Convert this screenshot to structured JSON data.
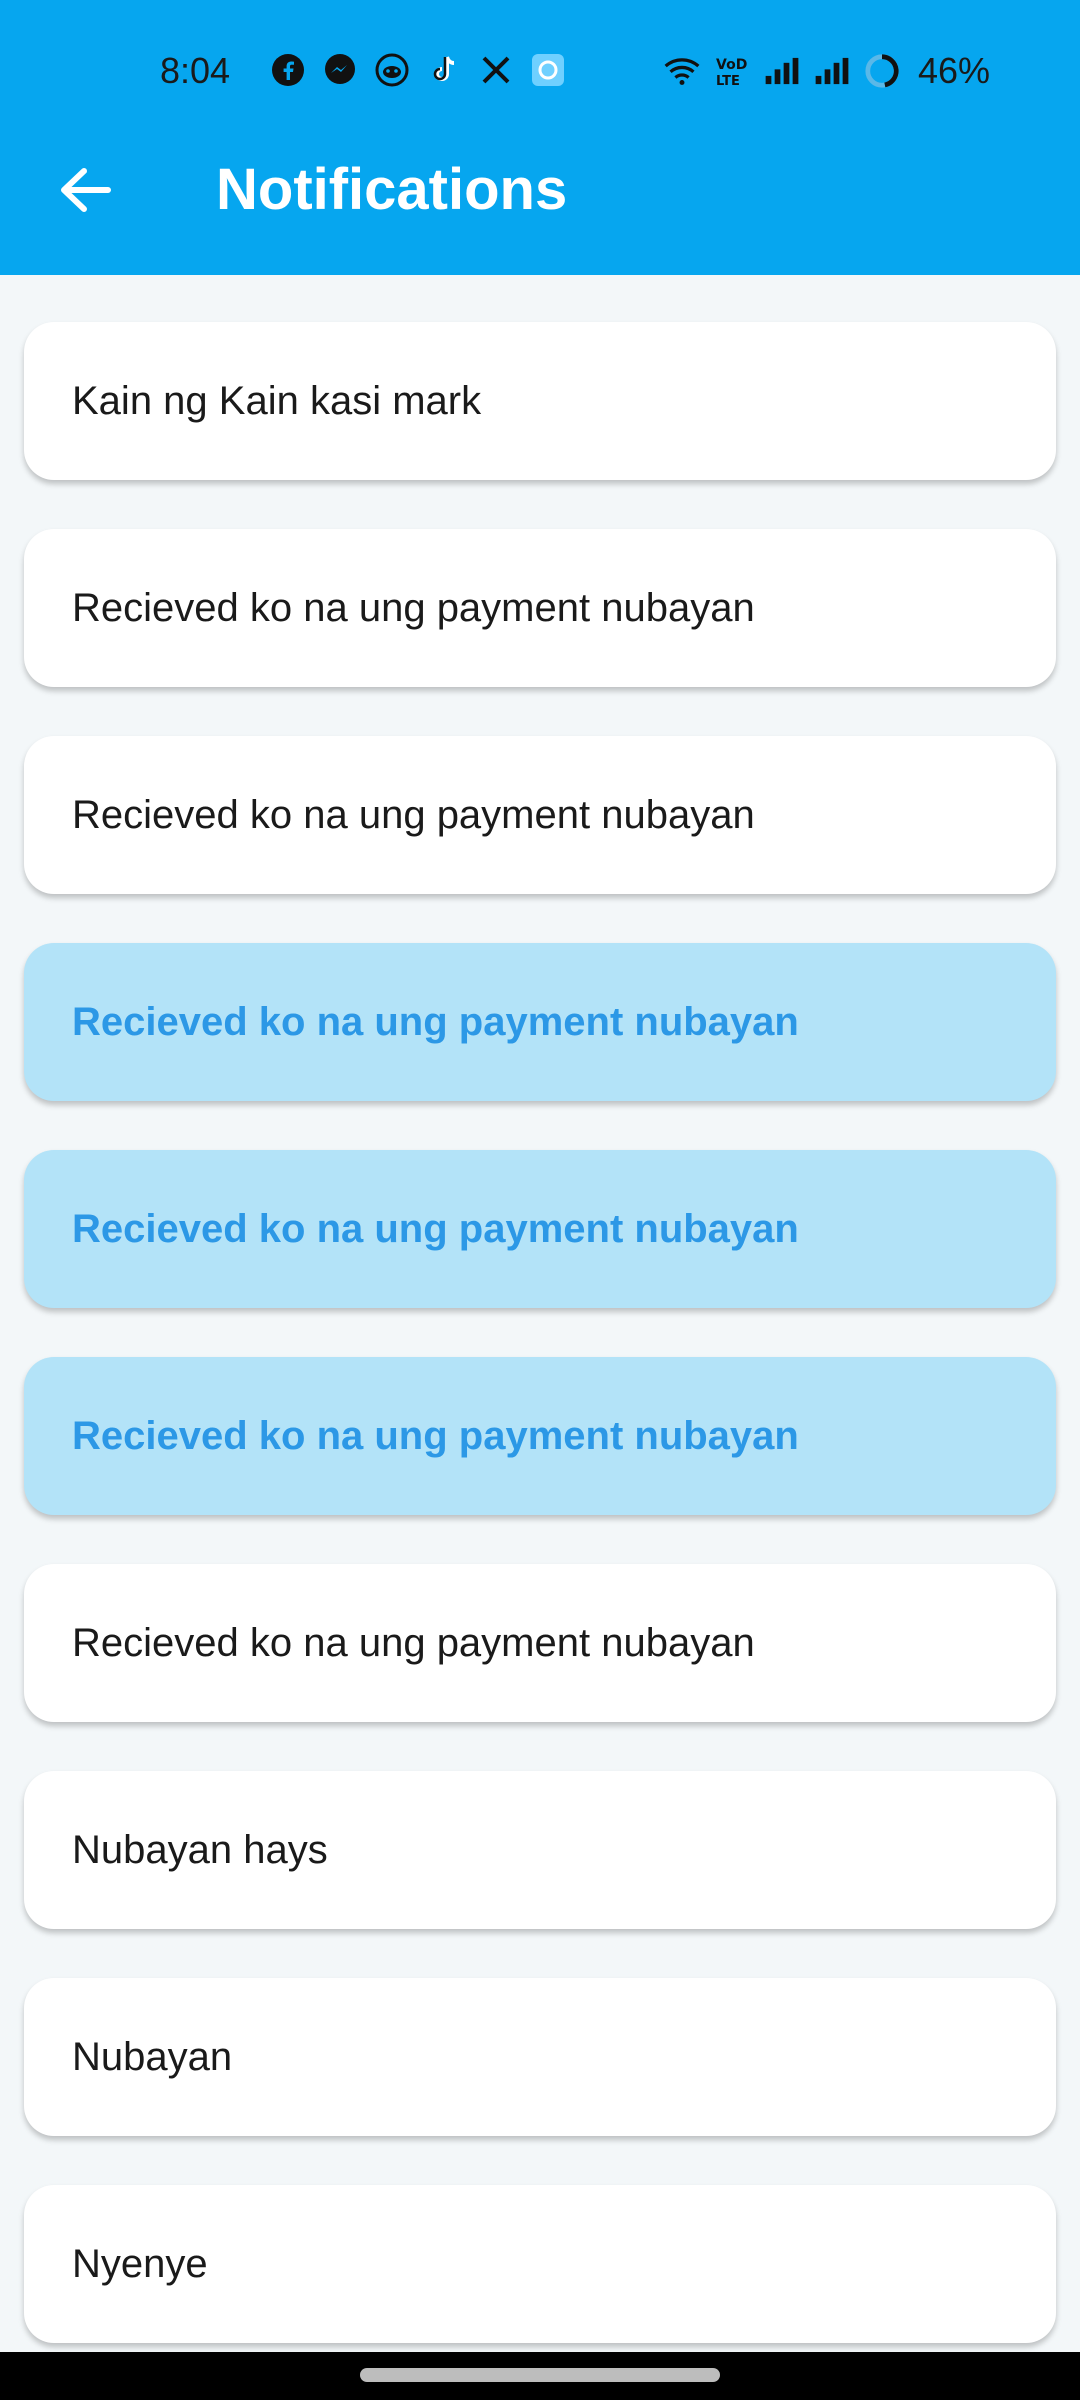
{
  "status_bar": {
    "time": "8:04",
    "battery": "46%",
    "icons": [
      "facebook-icon",
      "messenger-icon",
      "reddit-icon",
      "tiktok-icon",
      "x-icon",
      "app-icon",
      "wifi-icon",
      "volte-icon",
      "signal-icon",
      "signal-icon",
      "battery-ring-icon"
    ]
  },
  "header": {
    "title": "Notifications",
    "back_icon": "arrow-left-icon"
  },
  "notifications": [
    {
      "text": "Kain ng Kain kasi mark",
      "read": true
    },
    {
      "text": "Recieved ko na ung payment nubayan",
      "read": true
    },
    {
      "text": "Recieved ko na ung payment nubayan",
      "read": true
    },
    {
      "text": "Recieved ko na ung payment nubayan",
      "read": false
    },
    {
      "text": "Recieved ko na ung payment nubayan",
      "read": false
    },
    {
      "text": "Recieved ko na ung payment nubayan",
      "read": false
    },
    {
      "text": "Recieved ko na ung payment nubayan",
      "read": true
    },
    {
      "text": "Nubayan hays",
      "read": true
    },
    {
      "text": "Nubayan",
      "read": true
    },
    {
      "text": "Nyenye",
      "read": true
    }
  ],
  "colors": {
    "app_bar": "#06a6ef",
    "unread_bg": "#b3e3f8",
    "unread_text": "#2c98e6",
    "read_bg": "#ffffff"
  }
}
